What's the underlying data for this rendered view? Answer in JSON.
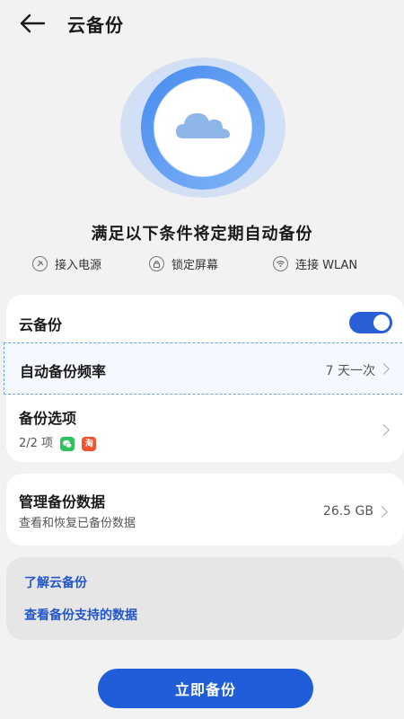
{
  "header": {
    "title": "云备份"
  },
  "conditions": {
    "title": "满足以下条件将定期自动备份",
    "items": [
      {
        "label": "接入电源",
        "icon": "power-plug-icon"
      },
      {
        "label": "锁定屏幕",
        "icon": "lock-icon"
      },
      {
        "label": "连接 WLAN",
        "icon": "wifi-icon"
      }
    ]
  },
  "settings": {
    "cloud_backup": {
      "label": "云备份",
      "enabled": true
    },
    "frequency": {
      "label": "自动备份频率",
      "value": "7 天一次"
    },
    "options": {
      "label": "备份选项",
      "sub": "2/2 项",
      "apps": [
        "wechat-icon",
        "taobao-icon"
      ]
    }
  },
  "manage": {
    "label": "管理备份数据",
    "sub": "查看和恢复已备份数据",
    "value": "26.5 GB"
  },
  "links": {
    "learn": "了解云备份",
    "supported": "查看备份支持的数据"
  },
  "actions": {
    "backup_now": "立即备份"
  },
  "colors": {
    "accent": "#1f5ed8",
    "link": "#2356c9",
    "toggle_on": "#2a5fd8"
  }
}
